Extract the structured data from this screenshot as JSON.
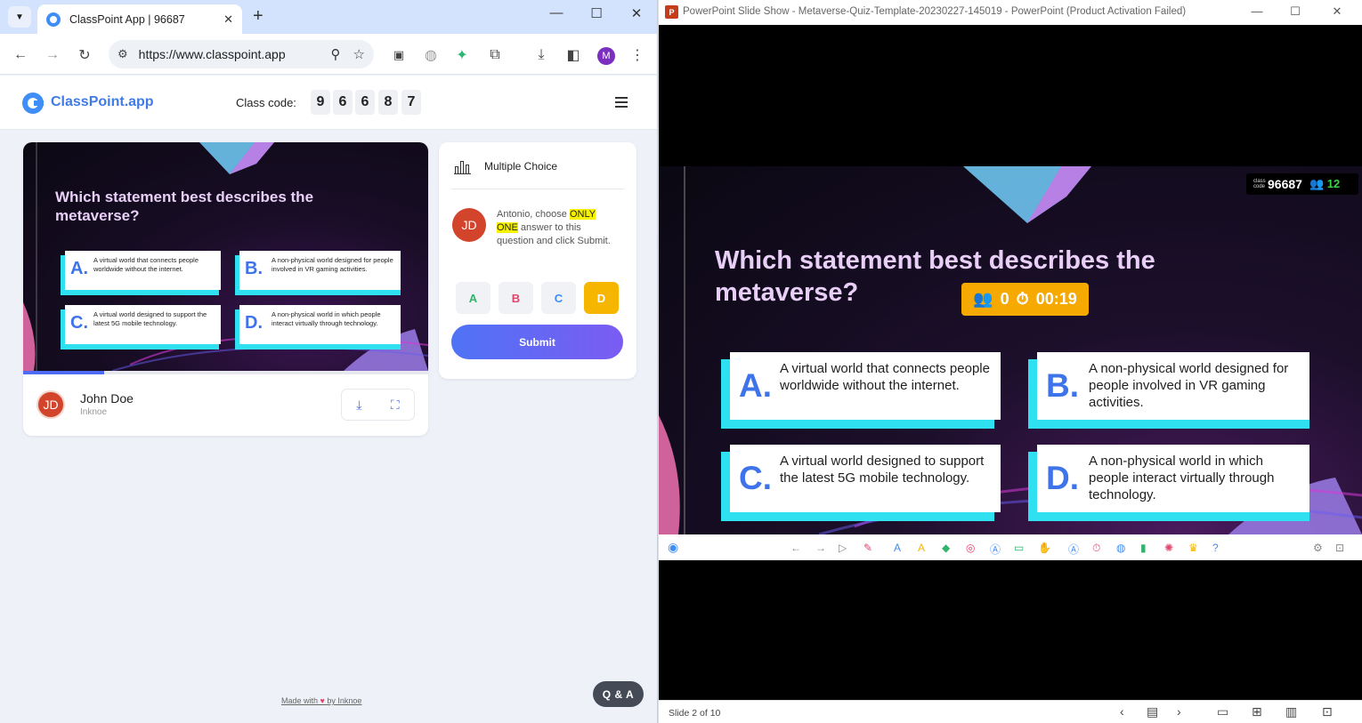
{
  "browser": {
    "tab_title": "ClassPoint App | 96687",
    "tab_close": "✕",
    "new_tab": "+",
    "url": "https://www.classpoint.app",
    "profile_initial": "M",
    "win_min": "—",
    "win_max": "☐",
    "win_close": "✕"
  },
  "classpoint": {
    "brand": "ClassPoint.app",
    "class_code_label": "Class code:",
    "class_code_digits": [
      "9",
      "6",
      "6",
      "8",
      "7"
    ],
    "mini_question": "Which statement best describes the metaverse?",
    "presenter_initials": "JD",
    "presenter_name": "John Doe",
    "presenter_org": "Inknoe",
    "question_type": "Multiple Choice",
    "student_initials": "JD",
    "instruction_pre": "Antonio, choose ",
    "instruction_hl1": "ONLY",
    "instruction_hl2": "ONE",
    "instruction_post": " answer to this question and click Submit.",
    "options": [
      "A",
      "B",
      "C",
      "D"
    ],
    "option_colors": [
      "#33b36b",
      "#e2456b",
      "#3f8ef5",
      "#f6b600"
    ],
    "selected_option": "D",
    "submit_label": "Submit",
    "footer_made": "Made with",
    "footer_by": "by Inknoe",
    "qa_label": "Q & A",
    "slide_progress": 0.2
  },
  "quiz": {
    "question": "Which statement best describes the metaverse?",
    "answers": [
      {
        "letter": "A.",
        "text": "A virtual world that connects people worldwide without the internet."
      },
      {
        "letter": "B.",
        "text": "A non-physical world designed for people involved in VR gaming activities."
      },
      {
        "letter": "C.",
        "text": "A virtual world designed to support the latest 5G mobile technology."
      },
      {
        "letter": "D.",
        "text": "A non-physical world in which people interact virtually through technology."
      }
    ]
  },
  "ppt": {
    "window_title": "PowerPoint Slide Show  -  Metaverse-Quiz-Template-20230227-145019 - PowerPoint (Product Activation Failed)",
    "class_word": "class",
    "code_word": "code",
    "class_code": "96687",
    "participants": "12",
    "responses": "0",
    "timer": "00:19",
    "slide_status": "Slide 2 of 10"
  }
}
